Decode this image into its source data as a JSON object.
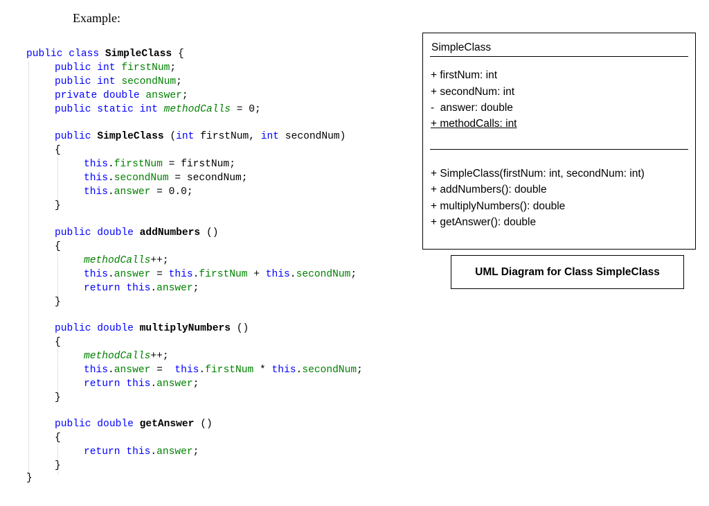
{
  "heading": "Example:",
  "code": {
    "class_decl": {
      "kw": "public class ",
      "name": "SimpleClass",
      "tail": " {"
    },
    "fields": [
      {
        "kw": "public int ",
        "name": "firstNum",
        "tail": ";"
      },
      {
        "kw": "public int ",
        "name": "secondNum",
        "tail": ";"
      },
      {
        "kw": "private double ",
        "name": "answer",
        "tail": ";"
      },
      {
        "kw": "public static int ",
        "name": "methodCalls",
        "tail": " = 0;"
      }
    ],
    "constructor": {
      "kw": "public ",
      "name": "SimpleClass",
      "params_open": " (",
      "p1_type": "int",
      "p1_name": " firstNum, ",
      "p2_type": "int",
      "p2_name": " secondNum)",
      "open_brace": "{",
      "close_brace": "}",
      "body": [
        {
          "kw": "this",
          "dot": ".",
          "field": "firstNum",
          "rest": " = firstNum;"
        },
        {
          "kw": "this",
          "dot": ".",
          "field": "secondNum",
          "rest": " = secondNum;"
        },
        {
          "kw": "this",
          "dot": ".",
          "field": "answer",
          "rest": " = 0.0;"
        }
      ]
    },
    "methods": [
      {
        "kw": "public double ",
        "name": "addNumbers",
        "parens": " ()",
        "open_brace": "{",
        "close_brace": "}",
        "static_line": "methodCalls",
        "static_tail": "++;",
        "assign_this": "this",
        "assign_dot": ".",
        "assign_field": "answer",
        "assign_eq": " = ",
        "op_this1": "this",
        "op_dot1": ".",
        "op_field1": "firstNum",
        "op": " + ",
        "op_this2": "this",
        "op_dot2": ".",
        "op_field2": "secondNum",
        "op_end": ";",
        "ret_kw": "return ",
        "ret_this": "this",
        "ret_dot": ".",
        "ret_field": "answer",
        "ret_end": ";"
      },
      {
        "kw": "public double ",
        "name": "multiplyNumbers",
        "parens": " ()",
        "open_brace": "{",
        "close_brace": "}",
        "static_line": "methodCalls",
        "static_tail": "++;",
        "assign_this": "this",
        "assign_dot": ".",
        "assign_field": "answer",
        "assign_eq": " =  ",
        "op_this1": "this",
        "op_dot1": ".",
        "op_field1": "firstNum",
        "op": " * ",
        "op_this2": "this",
        "op_dot2": ".",
        "op_field2": "secondNum",
        "op_end": ";",
        "ret_kw": "return ",
        "ret_this": "this",
        "ret_dot": ".",
        "ret_field": "answer",
        "ret_end": ";"
      },
      {
        "kw": "public double ",
        "name": "getAnswer",
        "parens": " ()",
        "open_brace": "{",
        "close_brace": "}",
        "ret_kw": "return ",
        "ret_this": "this",
        "ret_dot": ".",
        "ret_field": "answer",
        "ret_end": ";"
      }
    ],
    "class_close": "}"
  },
  "uml": {
    "class_name": "SimpleClass",
    "attributes": [
      "+ firstNum: int",
      "+ secondNum: int",
      "-  answer: double",
      "+ methodCalls: int"
    ],
    "operations": [
      "+ SimpleClass(firstNum: int, secondNum: int)",
      "+ addNumbers(): double",
      "+ multiplyNumbers(): double",
      "+ getAnswer(): double"
    ]
  },
  "caption": "UML Diagram for Class SimpleClass"
}
